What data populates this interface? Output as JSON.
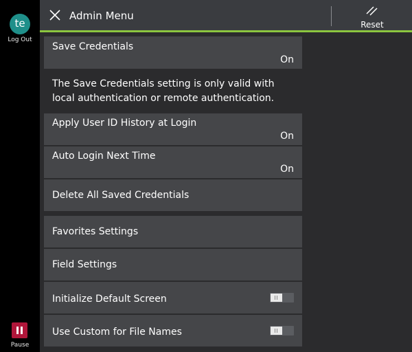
{
  "rail": {
    "avatar_initials": "te",
    "logout_label": "Log Out",
    "pause_label": "Pause",
    "pause_color": "#b0163a",
    "avatar_color": "#1f8f8a"
  },
  "header": {
    "title": "Admin Menu",
    "reset_label": "Reset",
    "close_icon": "close-icon",
    "reset_icon": "reset-icon",
    "accent_color": "#8cc63f"
  },
  "settings": {
    "save_credentials": {
      "label": "Save Credentials",
      "value": "On"
    },
    "note": "The Save Credentials setting is only valid with local authentication or remote authentication.",
    "apply_user_id_history": {
      "label": "Apply User ID History at Login",
      "value": "On"
    },
    "auto_login": {
      "label": "Auto Login Next Time",
      "value": "On"
    },
    "delete_credentials": {
      "label": "Delete All Saved Credentials"
    },
    "favorites": {
      "label": "Favorites Settings"
    },
    "field_settings": {
      "label": "Field Settings"
    },
    "initialize_default": {
      "label": "Initialize Default Screen",
      "toggle": "off"
    },
    "custom_file_names": {
      "label": "Use Custom for File Names",
      "toggle": "off"
    }
  }
}
